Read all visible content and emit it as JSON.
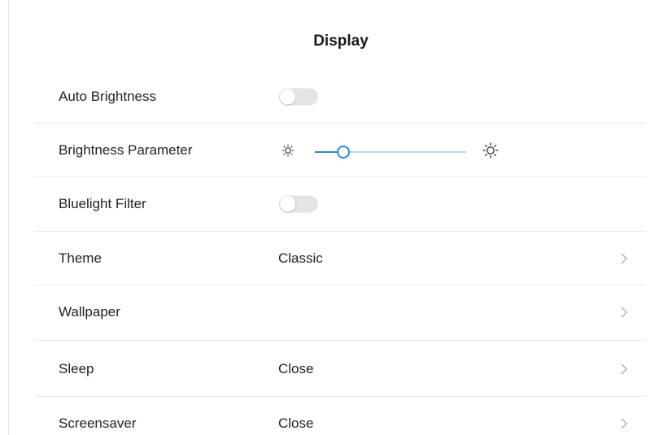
{
  "header": {
    "title": "Display"
  },
  "rows": {
    "auto_brightness": {
      "label": "Auto Brightness",
      "enabled": false
    },
    "brightness": {
      "label": "Brightness Parameter",
      "level": 0.19
    },
    "bluelight": {
      "label": "Bluelight Filter",
      "enabled": false
    },
    "theme": {
      "label": "Theme",
      "value": "Classic"
    },
    "wallpaper": {
      "label": "Wallpaper"
    },
    "sleep": {
      "label": "Sleep",
      "value": "Close"
    },
    "screensaver": {
      "label": "Screensaver",
      "value": "Close"
    }
  },
  "icons": {
    "sun_small": "brightness-low-icon",
    "sun_large": "brightness-high-icon",
    "chevron": "chevron-right-icon"
  },
  "colors": {
    "accent": "#2f86d8",
    "toggle_off": "#e4e4e4",
    "divider": "#e8e8e8"
  }
}
